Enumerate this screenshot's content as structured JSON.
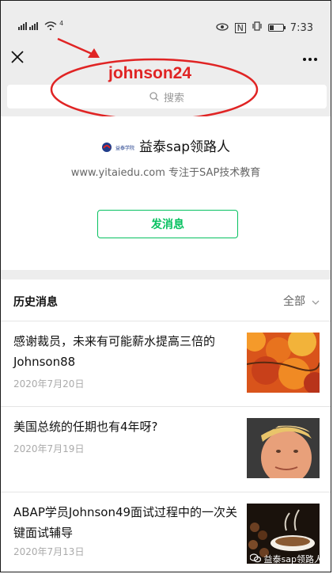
{
  "status_bar": {
    "signal_text": "56 46",
    "wifi_text": "4",
    "nfc_text": "N",
    "time": "7:33"
  },
  "header": {
    "annotation": "johnson24",
    "search_placeholder": "搜索"
  },
  "account": {
    "logo_text": "益泰学院",
    "name": "益泰sap领路人",
    "description": "www.yitaiedu.com 专注于SAP技术教育",
    "send_button": "发消息"
  },
  "history": {
    "title": "历史消息",
    "filter": "全部",
    "articles": [
      {
        "title": "感谢裁员，未来有可能薪水提高三倍的Johnson88",
        "date": "2020年7月20日",
        "thumb": "autumn-leaves"
      },
      {
        "title": "美国总统的任期也有4年呀?",
        "date": "2020年7月19日",
        "thumb": "portrait"
      },
      {
        "title": "ABAP学员Johnson49面试过程中的一次关键面试辅导",
        "date": "2020年7月13日",
        "thumb": "coffee-cup"
      }
    ]
  },
  "watermark": "益泰sap领路人",
  "colors": {
    "accent_green": "#07c160",
    "annotation_red": "#e02424",
    "header_bg": "#ededed"
  }
}
